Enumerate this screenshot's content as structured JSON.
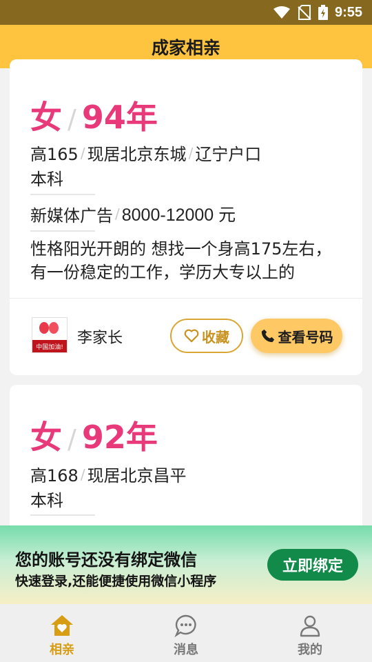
{
  "status_bar": {
    "time": "9:55"
  },
  "header": {
    "title": "成家相亲"
  },
  "cards": [
    {
      "gender": "女",
      "birth_year": "94年",
      "height": "高165",
      "residence": "现居北京东城",
      "hukou": "辽宁户口",
      "education": "本科",
      "job": "新媒体广告",
      "salary": "8000-12000 元",
      "intro": "性格阳光开朗的 想找一个身高175左右，有一份稳定的工作，学历大专以上的",
      "parent_name": "李家长",
      "avatar_text": "中国加油!",
      "favorite_label": "收藏",
      "call_label": "查看号码"
    },
    {
      "gender": "女",
      "birth_year": "92年",
      "height": "高168",
      "residence": "现居北京昌平",
      "education": "本科"
    }
  ],
  "bind_banner": {
    "title": "您的账号还没有绑定微信",
    "subtitle": "快速登录,还能便捷使用微信小程序",
    "button": "立即绑定"
  },
  "tabs": [
    {
      "label": "相亲",
      "icon": "home-heart-icon",
      "active": true
    },
    {
      "label": "消息",
      "icon": "chat-bubble-icon",
      "active": false
    },
    {
      "label": "我的",
      "icon": "user-icon",
      "active": false
    }
  ],
  "colors": {
    "header_bg": "#fec33f",
    "status_bar_bg": "#86681e",
    "accent_pink": "#e83a7a",
    "gold": "#d79d14",
    "bind_button": "#128a4a"
  }
}
